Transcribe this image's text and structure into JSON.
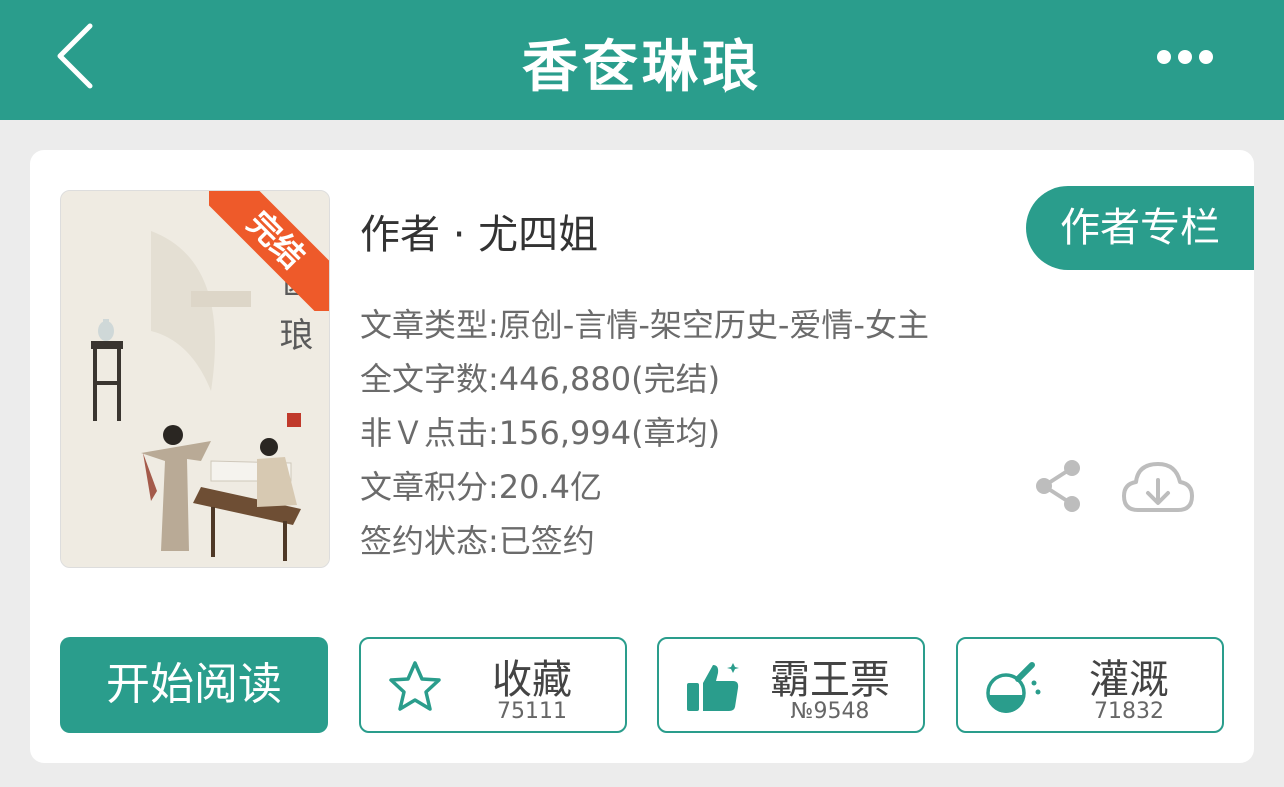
{
  "header": {
    "title": "香奁琳琅",
    "back_icon": "chevron-left-icon",
    "more_icon": "more-horizontal-icon"
  },
  "book": {
    "cover": {
      "ribbon": "完结",
      "title": "奁琅"
    },
    "author_label": "作者 · 尤四姐",
    "author_column_button": "作者专栏",
    "info": [
      "文章类型:原创-言情-架空历史-爱情-女主",
      "全文字数:446,880(完结)",
      "非Ｖ点击:156,994(章均)",
      "文章积分:20.4亿",
      "签约状态:已签约"
    ],
    "share_icon": "share-icon",
    "download_icon": "cloud-download-icon"
  },
  "actions": {
    "start_reading": "开始阅读",
    "favorite": {
      "label": "收藏",
      "count": "75111",
      "icon": "star-icon"
    },
    "bawangpiao": {
      "label": "霸王票",
      "count": "№9548",
      "icon": "thumbs-up-icon"
    },
    "irrigate": {
      "label": "灌溉",
      "count": "71832",
      "icon": "flask-icon"
    }
  },
  "colors": {
    "primary": "#2a9d8c",
    "ribbon": "#ee5a2a",
    "background": "#ececec",
    "text_dark": "#333333",
    "text_muted": "#6b6b6b"
  }
}
